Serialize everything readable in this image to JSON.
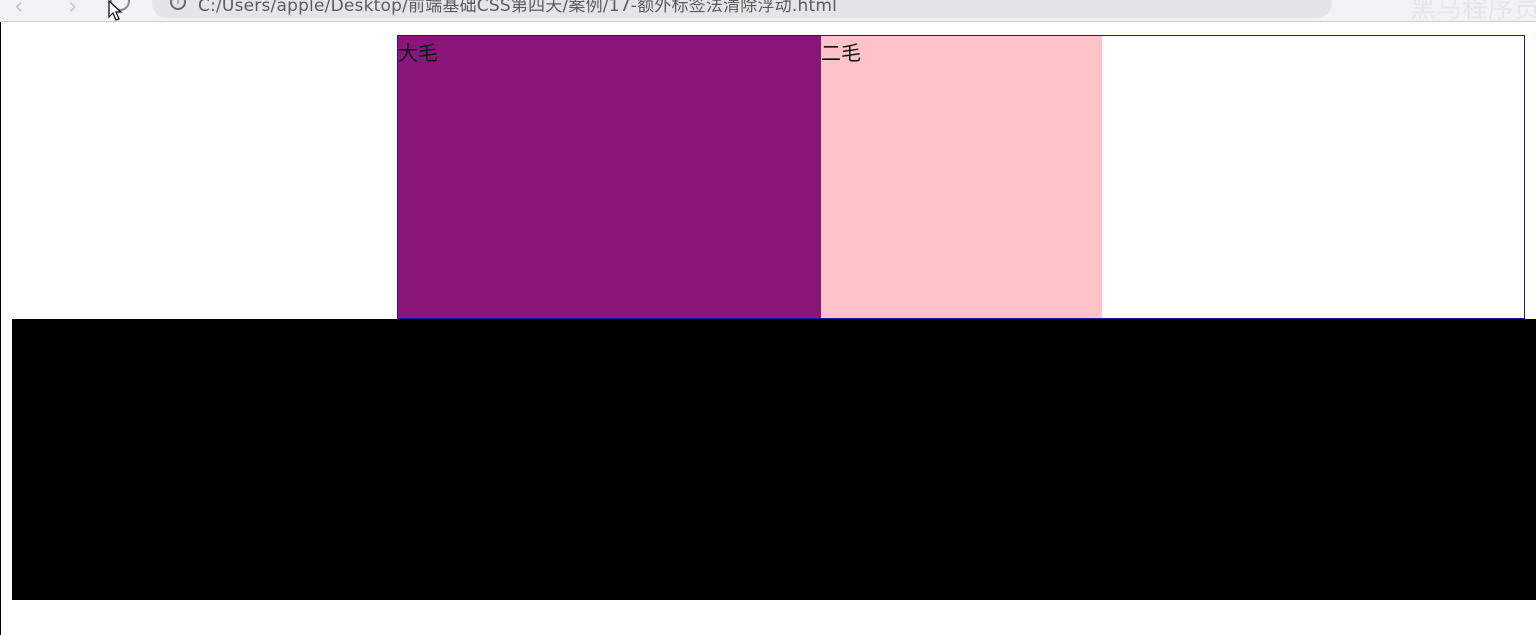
{
  "browser": {
    "back_icon": "‹",
    "forward_icon": "›",
    "info_icon": "i",
    "address": "C:/Users/apple/Desktop/前端基础CSS第四天/案例/17-额外标签法清除浮动.html",
    "watermark": "黑马程序员"
  },
  "page": {
    "box_one_label": "大毛",
    "box_two_label": "二毛"
  },
  "colors": {
    "container_border": "#1b1b9e",
    "box_one_bg": "#8a167a",
    "box_two_bg": "#ffc3c8",
    "footer_bg": "#000000"
  }
}
